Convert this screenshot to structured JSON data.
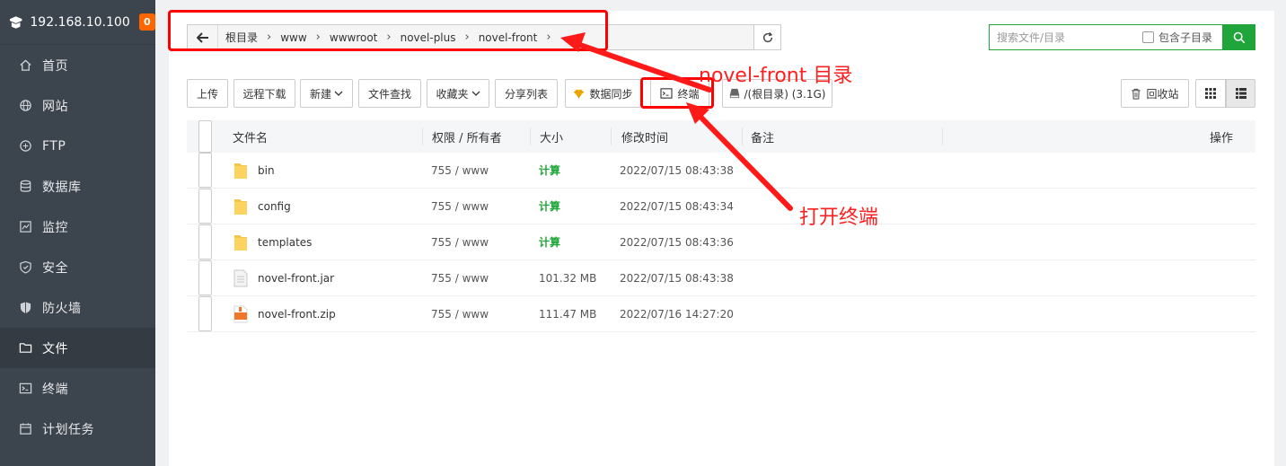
{
  "sidebar": {
    "server_ip": "192.168.10.100",
    "badge_count": "0",
    "items": [
      {
        "label": "首页",
        "icon": "home-icon"
      },
      {
        "label": "网站",
        "icon": "globe-icon"
      },
      {
        "label": "FTP",
        "icon": "ftp-icon"
      },
      {
        "label": "数据库",
        "icon": "database-icon"
      },
      {
        "label": "监控",
        "icon": "monitor-icon"
      },
      {
        "label": "安全",
        "icon": "shield-icon"
      },
      {
        "label": "防火墙",
        "icon": "firewall-icon"
      },
      {
        "label": "文件",
        "icon": "folder-icon"
      },
      {
        "label": "终端",
        "icon": "terminal-icon"
      },
      {
        "label": "计划任务",
        "icon": "calendar-icon"
      }
    ],
    "active_item": "文件"
  },
  "path": {
    "crumbs": [
      "根目录",
      "www",
      "wwwroot",
      "novel-plus",
      "novel-front"
    ]
  },
  "search": {
    "placeholder": "搜索文件/目录",
    "include_sub_label": "包含子目录"
  },
  "toolbar": {
    "upload": "上传",
    "remote_download": "远程下载",
    "new": "新建",
    "file_search": "文件查找",
    "favorites": "收藏夹",
    "share_list": "分享列表",
    "data_sync": "数据同步",
    "terminal": "终端",
    "disk": "/(根目录) (3.1G)",
    "recycle_bin": "回收站"
  },
  "table": {
    "headers": {
      "name": "文件名",
      "perm": "权限 / 所有者",
      "size": "大小",
      "mtime": "修改时间",
      "remark": "备注",
      "action": "操作"
    },
    "rows": [
      {
        "name": "bin",
        "type": "folder",
        "perm": "755 / www",
        "size": "计算",
        "mtime": "2022/07/15 08:43:38"
      },
      {
        "name": "config",
        "type": "folder",
        "perm": "755 / www",
        "size": "计算",
        "mtime": "2022/07/15 08:43:34"
      },
      {
        "name": "templates",
        "type": "folder",
        "perm": "755 / www",
        "size": "计算",
        "mtime": "2022/07/15 08:43:36"
      },
      {
        "name": "novel-front.jar",
        "type": "file",
        "perm": "755 / www",
        "size": "101.32 MB",
        "mtime": "2022/07/15 08:43:38"
      },
      {
        "name": "novel-front.zip",
        "type": "zip",
        "perm": "755 / www",
        "size": "111.47 MB",
        "mtime": "2022/07/16 14:27:20"
      }
    ]
  },
  "annotations": {
    "dir_label": "novel-front 目录",
    "terminal_label": "打开终端",
    "color": "#ff0000"
  }
}
